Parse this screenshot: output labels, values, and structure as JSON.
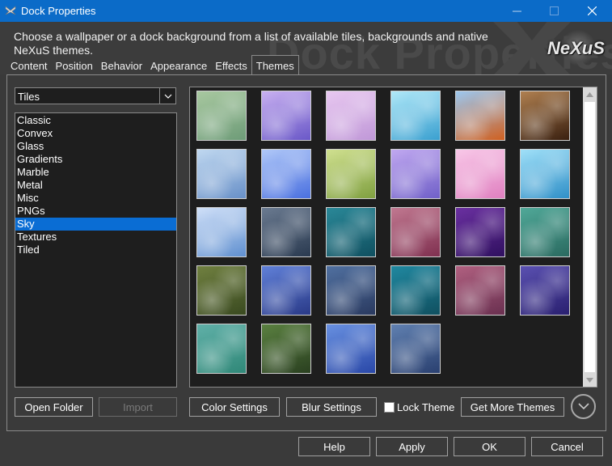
{
  "window": {
    "title": "Dock Properties"
  },
  "banner": {
    "description": "Choose a wallpaper or a dock background from a list of available tiles, backgrounds and native NeXuS themes.",
    "watermark": "Dock Properties",
    "logo_text": "NeXuS"
  },
  "tabs": [
    {
      "label": "Content"
    },
    {
      "label": "Position"
    },
    {
      "label": "Behavior"
    },
    {
      "label": "Appearance"
    },
    {
      "label": "Effects"
    },
    {
      "label": "Themes",
      "active": true
    }
  ],
  "combo": {
    "value": "Tiles"
  },
  "categories": [
    "Classic",
    "Convex",
    "Glass",
    "Gradients",
    "Marble",
    "Metal",
    "Misc",
    "PNGs",
    "Sky",
    "Textures",
    "Tiled"
  ],
  "selected_category": "Sky",
  "tiles": [
    {
      "c1": "#a8c8a0",
      "c2": "#6e9c78"
    },
    {
      "c1": "#c8b0f0",
      "c2": "#6a58c8"
    },
    {
      "c1": "#e8c8f0",
      "c2": "#c098d8"
    },
    {
      "c1": "#b0e8f8",
      "c2": "#3aa0d0"
    },
    {
      "c1": "#9cc8f0",
      "c2": "#d06020"
    },
    {
      "c1": "#b08050",
      "c2": "#3a2010"
    },
    {
      "c1": "#c0d8f0",
      "c2": "#6890c8"
    },
    {
      "c1": "#b0c8f8",
      "c2": "#4a70e0"
    },
    {
      "c1": "#d0e090",
      "c2": "#80a040"
    },
    {
      "c1": "#c0a8f0",
      "c2": "#7060c8"
    },
    {
      "c1": "#f8c8e8",
      "c2": "#e080c0"
    },
    {
      "c1": "#a0e0f8",
      "c2": "#3090c8"
    },
    {
      "c1": "#d0e0f8",
      "c2": "#6090d0"
    },
    {
      "c1": "#6a7a90",
      "c2": "#2a3a50"
    },
    {
      "c1": "#2a8898",
      "c2": "#105060"
    },
    {
      "c1": "#c07890",
      "c2": "#803050"
    },
    {
      "c1": "#6a30a0",
      "c2": "#301060"
    },
    {
      "c1": "#50a898",
      "c2": "#2a6a60"
    },
    {
      "c1": "#708040",
      "c2": "#3a4a20"
    },
    {
      "c1": "#6080d8",
      "c2": "#2a3a88"
    },
    {
      "c1": "#5070a0",
      "c2": "#2a3a60"
    },
    {
      "c1": "#2088a0",
      "c2": "#105060"
    },
    {
      "c1": "#b06080",
      "c2": "#6a3050"
    },
    {
      "c1": "#5a50b0",
      "c2": "#2a2070"
    },
    {
      "c1": "#60b0a8",
      "c2": "#308878"
    },
    {
      "c1": "#5a8040",
      "c2": "#2a4020"
    },
    {
      "c1": "#6890e0",
      "c2": "#2a48a8"
    },
    {
      "c1": "#6080b0",
      "c2": "#2a4070"
    }
  ],
  "buttons": {
    "open_folder": "Open Folder",
    "import": "Import",
    "color_settings": "Color Settings",
    "blur_settings": "Blur Settings",
    "lock_theme": "Lock Theme",
    "get_more_themes": "Get More Themes",
    "help": "Help",
    "apply": "Apply",
    "ok": "OK",
    "cancel": "Cancel"
  },
  "colors": {
    "titlebar": "#0b6bc8",
    "selection": "#0a6dd4",
    "background": "#3a3a3a"
  }
}
